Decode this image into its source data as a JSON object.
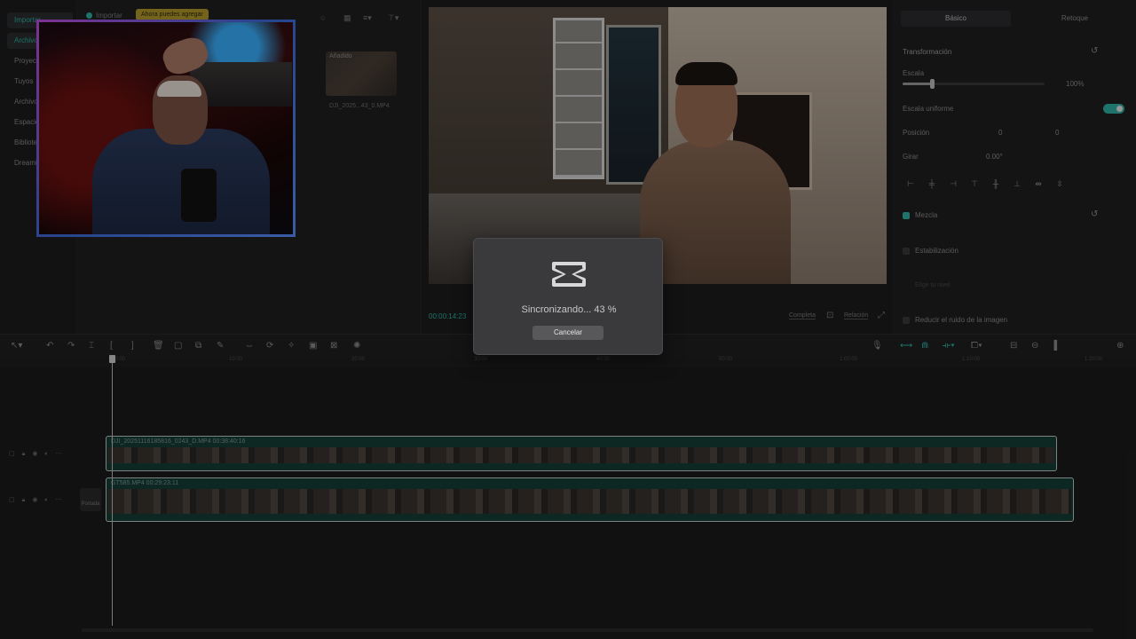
{
  "leftnav": {
    "items": [
      {
        "label": "Importar",
        "active": true
      },
      {
        "label": "Archivo",
        "active": true
      },
      {
        "label": "Proyecto"
      },
      {
        "label": "Tuyos"
      },
      {
        "label": "Archivo"
      },
      {
        "label": "Espacio"
      },
      {
        "label": "Biblioteca"
      },
      {
        "label": "Dreamina"
      }
    ]
  },
  "media": {
    "import_label": "Importar",
    "tooltip": "Ahora puedes agregar",
    "thumb_added_label": "Añadido",
    "thumb_caption": "DJI_2025...43_0.MP4"
  },
  "preview": {
    "timecode": "00:00:14:23",
    "buttons": {
      "complete": "Completa",
      "ratio": "Relación"
    }
  },
  "inspector": {
    "tabs": [
      "Básico",
      "Retoque"
    ],
    "transform_label": "Transformación",
    "scale_label": "Escala",
    "scale_value": "100%",
    "uniform_scale_label": "Escala uniforme",
    "position_label": "Posición",
    "position_x": "0",
    "position_y": "0",
    "rotate_label": "Girar",
    "rotate_value": "0.00°",
    "blend_label": "Mezcla",
    "stabilization_label": "Estabilización",
    "stabilization_hint": "Elige tu nivel",
    "denoise_label": "Reducir el ruido de la imagen"
  },
  "ruler": {
    "ticks": [
      "00:00",
      "10:00",
      "20:00",
      "30:00",
      "40:00",
      "50:00",
      "1:00:00",
      "1:10:00",
      "1:20:00"
    ]
  },
  "timeline": {
    "clips": [
      {
        "title": "DJI_20251116185816_0243_D.MP4   00:38:40:16"
      },
      {
        "title": "GT585.MP4   00:29:23:11"
      }
    ],
    "portada_label": "Portada"
  },
  "dialog": {
    "message": "Sincronizando... 43 %",
    "progress_percent": 43,
    "cancel_label": "Cancelar"
  },
  "colors": {
    "accent": "#2fb3a4",
    "clip_bg": "#143c37"
  }
}
